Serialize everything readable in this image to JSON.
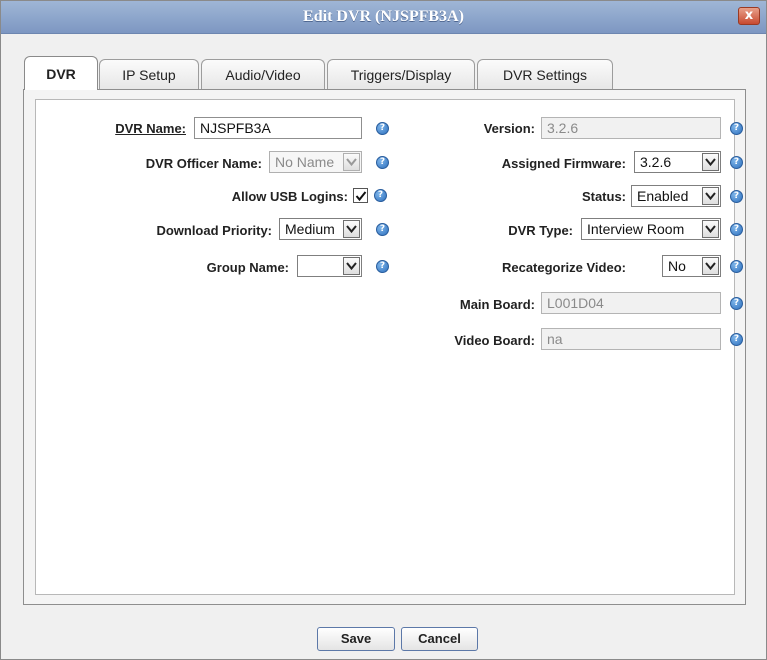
{
  "dialog": {
    "title": "Edit DVR (NJSPFB3A)",
    "close_label": "x"
  },
  "tabs": [
    {
      "label": "DVR",
      "active": true
    },
    {
      "label": "IP Setup",
      "active": false
    },
    {
      "label": "Audio/Video",
      "active": false
    },
    {
      "label": "Triggers/Display",
      "active": false
    },
    {
      "label": "DVR Settings",
      "active": false
    }
  ],
  "left_form": {
    "dvr_name": {
      "label": "DVR Name:",
      "value": "NJSPFB3A"
    },
    "dvr_officer_name": {
      "label": "DVR Officer Name:",
      "value": "No Name",
      "disabled": true
    },
    "allow_usb_logins": {
      "label": "Allow USB Logins:",
      "checked": true
    },
    "download_priority": {
      "label": "Download Priority:",
      "value": "Medium"
    },
    "group_name": {
      "label": "Group Name:",
      "value": ""
    }
  },
  "right_form": {
    "version": {
      "label": "Version:",
      "value": "3.2.6"
    },
    "assigned_firmware": {
      "label": "Assigned Firmware:",
      "value": "3.2.6"
    },
    "status": {
      "label": "Status:",
      "value": "Enabled"
    },
    "dvr_type": {
      "label": "DVR Type:",
      "value": "Interview Room"
    },
    "recategorize_video": {
      "label": "Recategorize Video:",
      "value": "No"
    },
    "main_board": {
      "label": "Main Board:",
      "value": "L001D04"
    },
    "video_board": {
      "label": "Video Board:",
      "value": "na"
    }
  },
  "help_icon_glyph": "?",
  "buttons": {
    "save": "Save",
    "cancel": "Cancel"
  },
  "colors": {
    "titlebar": "#8aa4cc",
    "help_icon": "#2d6fbd",
    "close_button": "#c84a30"
  }
}
